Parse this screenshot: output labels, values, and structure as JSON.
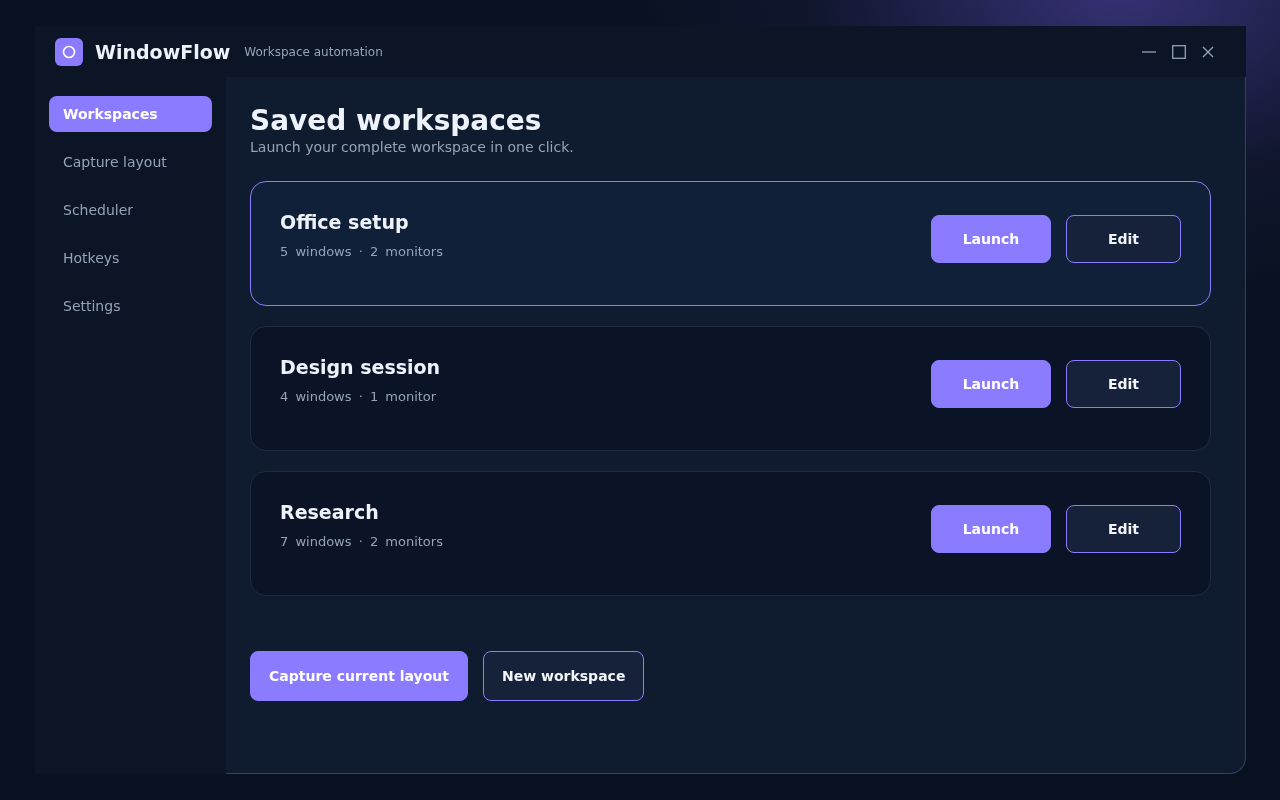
{
  "window": {
    "title": "WindowFlow",
    "subtitle": "Workspace automation"
  },
  "sidebar": {
    "items": [
      {
        "label": "Workspaces",
        "selected": true
      },
      {
        "label": "Capture layout",
        "selected": false
      },
      {
        "label": "Scheduler",
        "selected": false
      },
      {
        "label": "Hotkeys",
        "selected": false
      },
      {
        "label": "Settings",
        "selected": false
      }
    ]
  },
  "main": {
    "title": "Saved workspaces",
    "subtitle": "Launch your complete workspace in one click."
  },
  "workspaces": [
    {
      "name": "Office setup",
      "details": "5 windows · 2 monitors",
      "selected": true,
      "actions": [
        {
          "label": "Launch",
          "kind": "primary"
        },
        {
          "label": "Edit",
          "kind": "secondary"
        }
      ]
    },
    {
      "name": "Design session",
      "details": "4 windows · 1 monitor",
      "selected": false,
      "actions": [
        {
          "label": "Launch",
          "kind": "primary"
        },
        {
          "label": "Edit",
          "kind": "secondary"
        }
      ]
    },
    {
      "name": "Research",
      "details": "7 windows · 2 monitors",
      "selected": false,
      "actions": [
        {
          "label": "Launch",
          "kind": "primary"
        },
        {
          "label": "Edit",
          "kind": "secondary"
        }
      ]
    }
  ],
  "footer_buttons": [
    {
      "label": "Capture current layout",
      "kind": "primary"
    },
    {
      "label": "New workspace",
      "kind": "secondary"
    }
  ]
}
